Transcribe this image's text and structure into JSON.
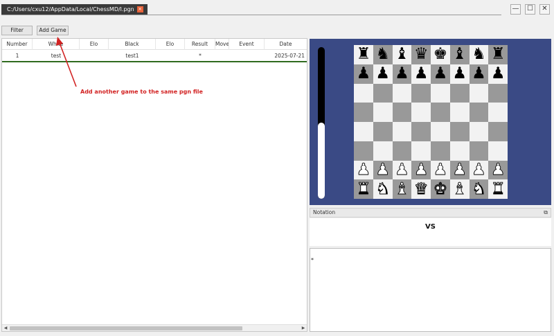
{
  "window": {
    "tab_title": "C:/Users/cxu12/AppData/Local/ChessMD/l.pgn",
    "tab_close": "×",
    "minimize": "—",
    "maximize": "☐",
    "close": "✕"
  },
  "toolbar": {
    "filter_label": "Filter",
    "add_game_label": "Add Game"
  },
  "table": {
    "columns": [
      "Number",
      "White",
      "Elo",
      "Black",
      "Elo",
      "Result",
      "Move",
      "Event",
      "Date"
    ],
    "rows": [
      {
        "number": "1",
        "white": "test",
        "white_elo": "",
        "black": "test1",
        "black_elo": "",
        "result": "*",
        "move": "",
        "event": "",
        "date": "2025-07-21"
      }
    ]
  },
  "annotation": {
    "text": "Add another game to the same pgn file",
    "color": "#d22222"
  },
  "evaluation": {
    "white_fraction": 0.5
  },
  "board": {
    "light_color": "#f2f2f2",
    "dark_color": "#999999",
    "background": "#3a4a85",
    "ranks": [
      [
        "bR",
        "bN",
        "bB",
        "bQ",
        "bK",
        "bB",
        "bN",
        "bR"
      ],
      [
        "bP",
        "bP",
        "bP",
        "bP",
        "bP",
        "bP",
        "bP",
        "bP"
      ],
      [
        "",
        "",
        "",
        "",
        "",
        "",
        "",
        ""
      ],
      [
        "",
        "",
        "",
        "",
        "",
        "",
        "",
        ""
      ],
      [
        "",
        "",
        "",
        "",
        "",
        "",
        "",
        ""
      ],
      [
        "",
        "",
        "",
        "",
        "",
        "",
        "",
        ""
      ],
      [
        "wP",
        "wP",
        "wP",
        "wP",
        "wP",
        "wP",
        "wP",
        "wP"
      ],
      [
        "wR",
        "wN",
        "wB",
        "wQ",
        "wK",
        "wB",
        "wN",
        "wR"
      ]
    ]
  },
  "notation": {
    "header": "Notation",
    "float_icon": "⧉",
    "vs_text": "VS",
    "moves": "*"
  }
}
